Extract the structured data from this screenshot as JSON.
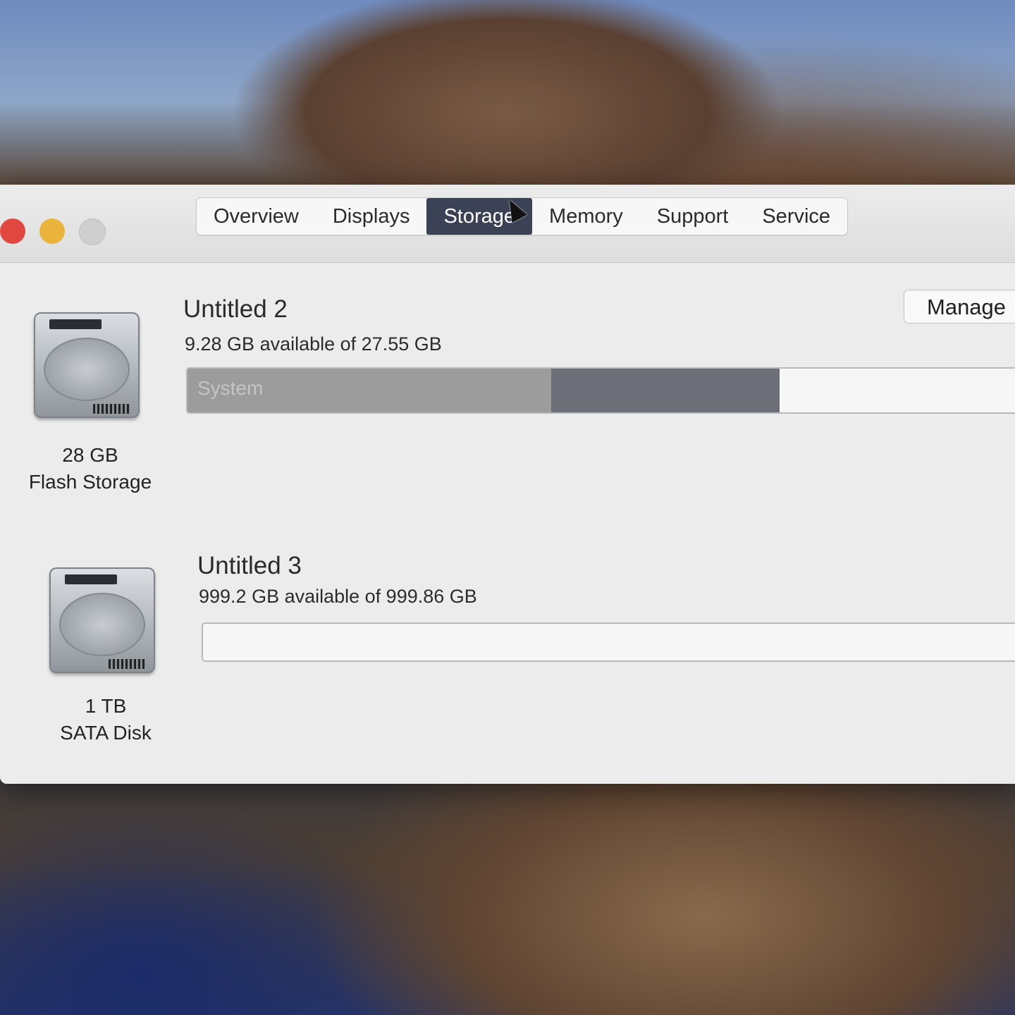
{
  "tabs": [
    {
      "label": "Overview",
      "active": false
    },
    {
      "label": "Displays",
      "active": false
    },
    {
      "label": "Storage",
      "active": true
    },
    {
      "label": "Memory",
      "active": false
    },
    {
      "label": "Support",
      "active": false
    },
    {
      "label": "Service",
      "active": false
    }
  ],
  "manage_button": "Manage",
  "drives": [
    {
      "icon": "hard-drive-icon",
      "capacity": "28 GB",
      "type": "Flash Storage",
      "volume_name": "Untitled 2",
      "available_text": "9.28 GB available of 27.55 GB",
      "segments": [
        {
          "label": "System",
          "fraction": 0.43,
          "color": "#9c9c9c"
        },
        {
          "label": "",
          "fraction": 0.27,
          "color": "#6c6e78"
        }
      ]
    },
    {
      "icon": "hard-drive-icon",
      "capacity": "1 TB",
      "type": "SATA Disk",
      "volume_name": "Untitled 3",
      "available_text": "999.2 GB available of 999.86 GB",
      "segments": []
    }
  ],
  "colors": {
    "active_tab": "#3b4256",
    "close": "#e0473f",
    "minimize": "#e9b33c"
  }
}
